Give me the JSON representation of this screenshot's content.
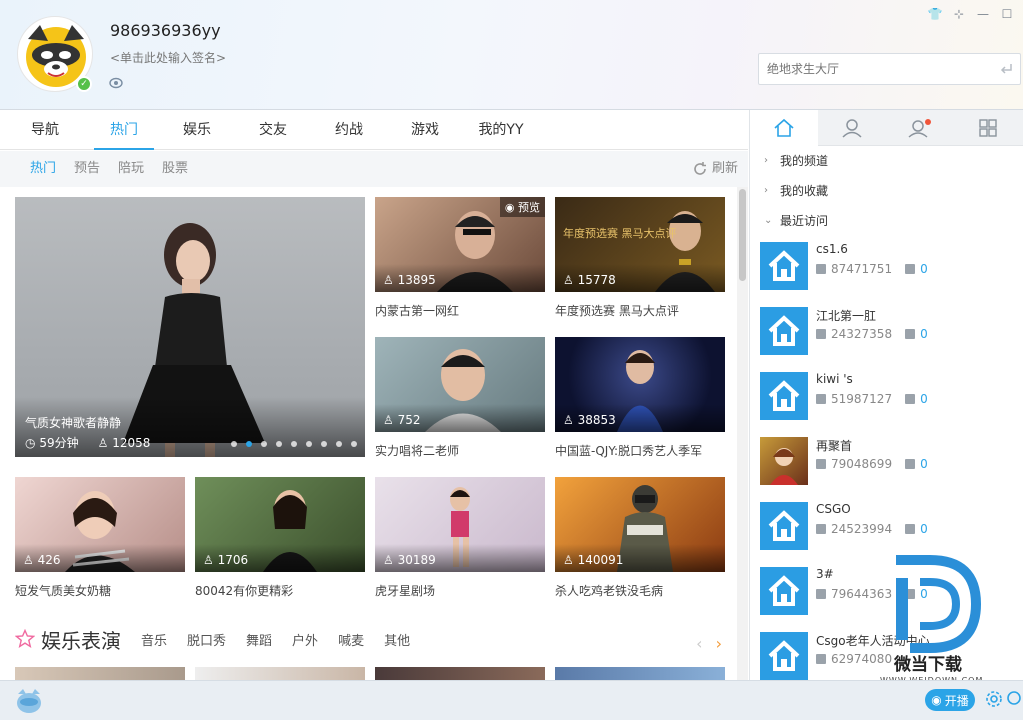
{
  "profile": {
    "username": "986936936yy",
    "signature": "<单击此处输入签名>"
  },
  "search": {
    "placeholder": "绝地求生大厅"
  },
  "main_tabs": [
    {
      "label": "导航"
    },
    {
      "label": "热门"
    },
    {
      "label": "娱乐"
    },
    {
      "label": "交友"
    },
    {
      "label": "约战"
    },
    {
      "label": "游戏"
    },
    {
      "label": "我的YY"
    }
  ],
  "active_main_tab": "热门",
  "sub_tabs": [
    {
      "label": "热门"
    },
    {
      "label": "预告"
    },
    {
      "label": "陪玩"
    },
    {
      "label": "股票"
    }
  ],
  "refresh_label": "刷新",
  "featured": {
    "title": "气质女神歌者静静",
    "duration": "59分钟",
    "viewers": "12058"
  },
  "cards": [
    {
      "title": "内蒙古第一网红",
      "viewers": "13895",
      "badge": "预览"
    },
    {
      "title": "年度预选赛 黑马大点评",
      "viewers": "15778",
      "overlay_text": "年度预选赛 黑马大点评"
    },
    {
      "title": "实力唱将二老师",
      "viewers": "752"
    },
    {
      "title": "中国蓝-QJY:脱口秀艺人季军",
      "viewers": "38853"
    },
    {
      "title": "短发气质美女奶糖",
      "viewers": "426"
    },
    {
      "title": "80042有你更精彩",
      "viewers": "1706"
    },
    {
      "title": "虎牙星剧场",
      "viewers": "30189"
    },
    {
      "title": "杀人吃鸡老铁没毛病",
      "viewers": "140091"
    }
  ],
  "section": {
    "title": "娱乐表演",
    "tags": [
      "音乐",
      "脱口秀",
      "舞蹈",
      "户外",
      "喊麦",
      "其他"
    ]
  },
  "right_panel": {
    "tree": [
      {
        "label": "我的频道",
        "expanded": false
      },
      {
        "label": "我的收藏",
        "expanded": false
      },
      {
        "label": "最近访问",
        "expanded": true
      }
    ],
    "recent": [
      {
        "name": "cs1.6",
        "id": "87471751",
        "count": "0"
      },
      {
        "name": "江北第一肛",
        "id": "24327358",
        "count": "0"
      },
      {
        "name": "kiwi 's",
        "id": "51987127",
        "count": "0"
      },
      {
        "name": "再聚首",
        "id": "79048699",
        "count": "0"
      },
      {
        "name": "CSGO",
        "id": "24523994",
        "count": "0"
      },
      {
        "name": "3#",
        "id": "79644363",
        "count": "0"
      },
      {
        "name": "Csgo老年人活动中心",
        "id": "62974080",
        "count": ""
      }
    ]
  },
  "watermark": {
    "text": "微当下载",
    "url": "WWW.WEIDOWN.COM"
  },
  "bottom": {
    "live_label": "开播"
  },
  "colors": {
    "accent": "#2ba4e7",
    "header_bg": "#eef4fb",
    "bottom_bg": "#e9eef3"
  }
}
